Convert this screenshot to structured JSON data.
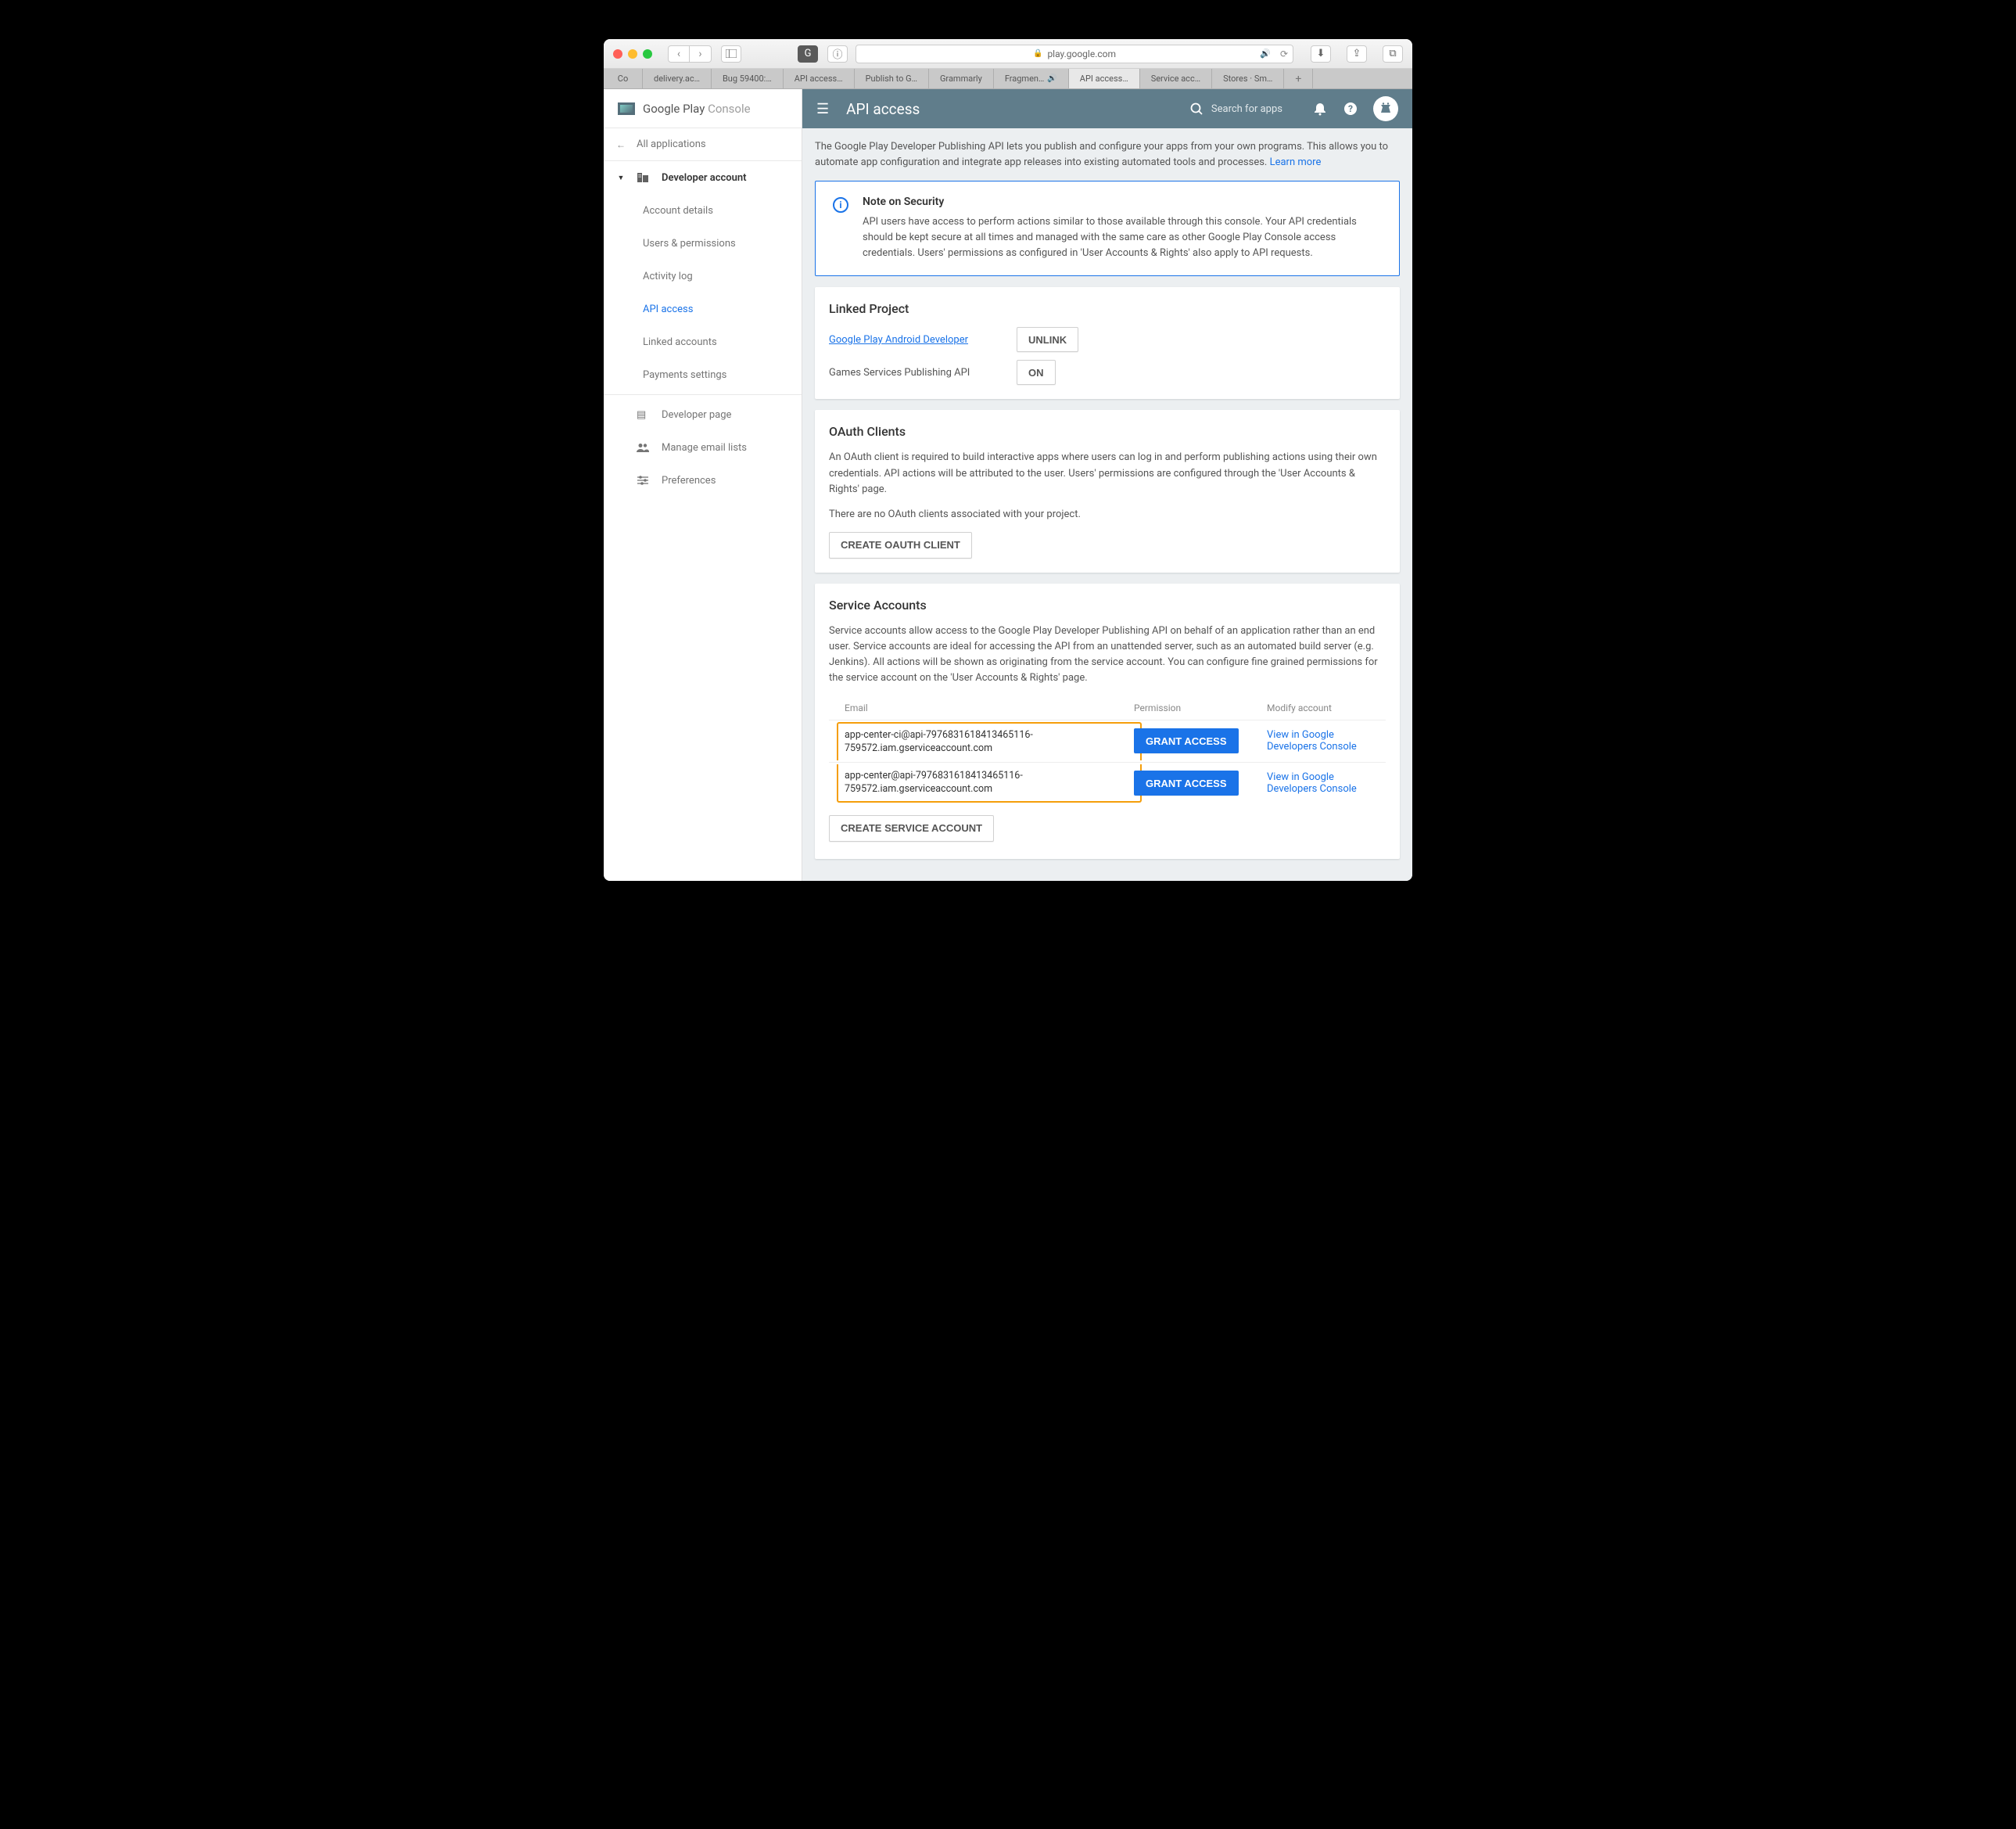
{
  "browser": {
    "url_host": "play.google.com",
    "tabs": [
      "Co",
      "delivery.ac…",
      "Bug 59400:…",
      "API access…",
      "Publish to G…",
      "Grammarly",
      "Fragmen…",
      "API access…",
      "Service acc…",
      "Stores · Sm…"
    ]
  },
  "brand": {
    "name": "Google Play",
    "suffix": "Console"
  },
  "appbar": {
    "title": "API access",
    "search": "Search for apps"
  },
  "sidebar": {
    "all_apps": "All applications",
    "dev_acct": "Developer account",
    "subs": [
      "Account details",
      "Users & permissions",
      "Activity log",
      "API access",
      "Linked accounts",
      "Payments settings"
    ],
    "bottom": [
      "Developer page",
      "Manage email lists",
      "Preferences"
    ]
  },
  "intro": {
    "text": "The Google Play Developer Publishing API lets you publish and configure your apps from your own programs. This allows you to automate app configuration and integrate app releases into existing automated tools and processes.",
    "link": "Learn more"
  },
  "note": {
    "title": "Note on Security",
    "body": "API users have access to perform actions similar to those available through this console. Your API credentials should be kept secure at all times and managed with the same care as other Google Play Console access credentials. Users' permissions as configured in 'User Accounts & Rights' also apply to API requests."
  },
  "linked": {
    "heading": "Linked Project",
    "r1_label": "Google Play Android Developer",
    "r1_btn": "UNLINK",
    "r2_label": "Games Services Publishing API",
    "r2_btn": "ON"
  },
  "oauth": {
    "heading": "OAuth Clients",
    "body": "An OAuth client is required to build interactive apps where users can log in and perform publishing actions using their own credentials. API actions will be attributed to the user. Users' permissions are configured through the 'User Accounts & Rights' page.",
    "empty": "There are no OAuth clients associated with your project.",
    "create": "CREATE OAUTH CLIENT"
  },
  "svc": {
    "heading": "Service Accounts",
    "body": "Service accounts allow access to the Google Play Developer Publishing API on behalf of an application rather than an end user. Service accounts are ideal for accessing the API from an unattended server, such as an automated build server (e.g. Jenkins). All actions will be shown as originating from the service account. You can configure fine grained permissions for the service account on the 'User Accounts & Rights' page.",
    "cols": {
      "email": "Email",
      "perm": "Permission",
      "modify": "Modify account"
    },
    "rows": [
      {
        "email": "app-center-ci@api-7976831618413465116-759572.iam.gserviceaccount.com",
        "perm": "GRANT ACCESS",
        "link": "View in Google Developers Console"
      },
      {
        "email": "app-center@api-7976831618413465116-759572.iam.gserviceaccount.com",
        "perm": "GRANT ACCESS",
        "link": "View in Google Developers Console"
      }
    ],
    "create": "CREATE SERVICE ACCOUNT"
  }
}
